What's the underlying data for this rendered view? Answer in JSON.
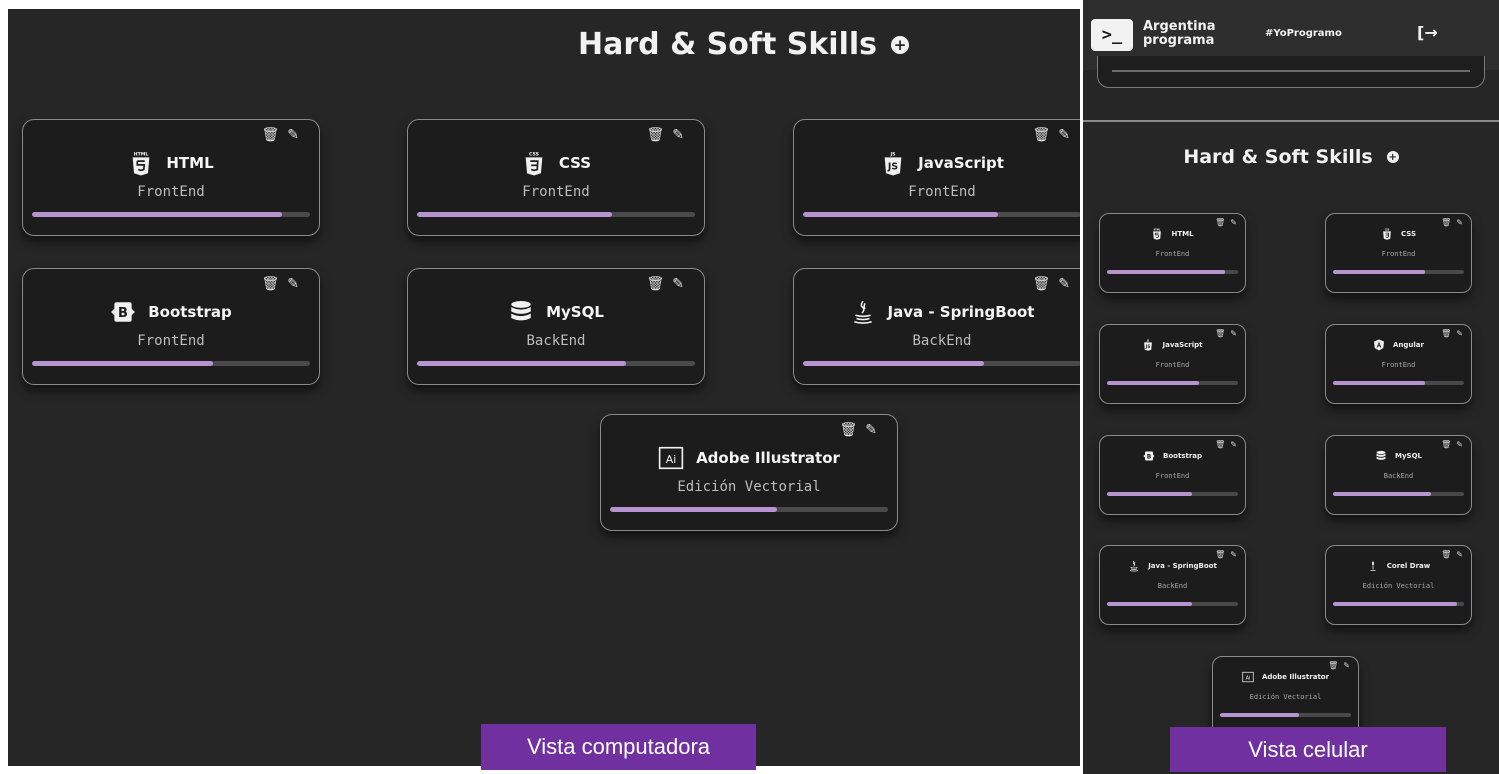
{
  "desktop": {
    "title": "Hard & Soft Skills",
    "add_icon": "plus-circle-icon",
    "caption": "Vista computadora",
    "skills": [
      {
        "name": "HTML",
        "category": "FrontEnd",
        "icon": "html5-icon",
        "level": 0.9
      },
      {
        "name": "CSS",
        "category": "FrontEnd",
        "icon": "css3-icon",
        "level": 0.7
      },
      {
        "name": "JavaScript",
        "category": "FrontEnd",
        "icon": "javascript-icon",
        "level": 0.7
      },
      {
        "name": "Bootstrap",
        "category": "FrontEnd",
        "icon": "bootstrap-icon",
        "level": 0.65
      },
      {
        "name": "MySQL",
        "category": "BackEnd",
        "icon": "database-icon",
        "level": 0.75
      },
      {
        "name": "Java - SpringBoot",
        "category": "BackEnd",
        "icon": "java-icon",
        "level": 0.65
      },
      {
        "name": "Adobe Illustrator",
        "category": "Edición Vectorial",
        "icon": "adobe-illustrator-icon",
        "level": 0.6
      }
    ]
  },
  "mobile": {
    "brand": "Argentina\nprograma",
    "brand_line1": "Argentina",
    "brand_line2": "programa",
    "logo_glyph": ">_",
    "hashtag": "#YoProgramo",
    "logout_glyph": "[→",
    "title": "Hard & Soft Skills",
    "caption": "Vista celular",
    "skills": [
      {
        "name": "HTML",
        "category": "FrontEnd",
        "icon": "html5-icon",
        "level": 0.9
      },
      {
        "name": "CSS",
        "category": "FrontEnd",
        "icon": "css3-icon",
        "level": 0.7
      },
      {
        "name": "JavaScript",
        "category": "FrontEnd",
        "icon": "javascript-icon",
        "level": 0.7
      },
      {
        "name": "Angular",
        "category": "FrontEnd",
        "icon": "angular-icon",
        "level": 0.7
      },
      {
        "name": "Bootstrap",
        "category": "FrontEnd",
        "icon": "bootstrap-icon",
        "level": 0.65
      },
      {
        "name": "MySQL",
        "category": "BackEnd",
        "icon": "database-icon",
        "level": 0.75
      },
      {
        "name": "Java - SpringBoot",
        "category": "BackEnd",
        "icon": "java-icon",
        "level": 0.65
      },
      {
        "name": "Corel Draw",
        "category": "Edición Vectorial",
        "icon": "coreldraw-icon",
        "level": 0.95
      },
      {
        "name": "Adobe Illustrator",
        "category": "Edición Vectorial",
        "icon": "adobe-illustrator-icon",
        "level": 0.6
      }
    ]
  },
  "actions": {
    "delete_icon": "trash-icon",
    "edit_icon": "edit-icon"
  },
  "colors": {
    "background": "#262626",
    "card": "#1c1c1c",
    "progress": "#b794cf",
    "caption_bg": "#7030a0"
  }
}
